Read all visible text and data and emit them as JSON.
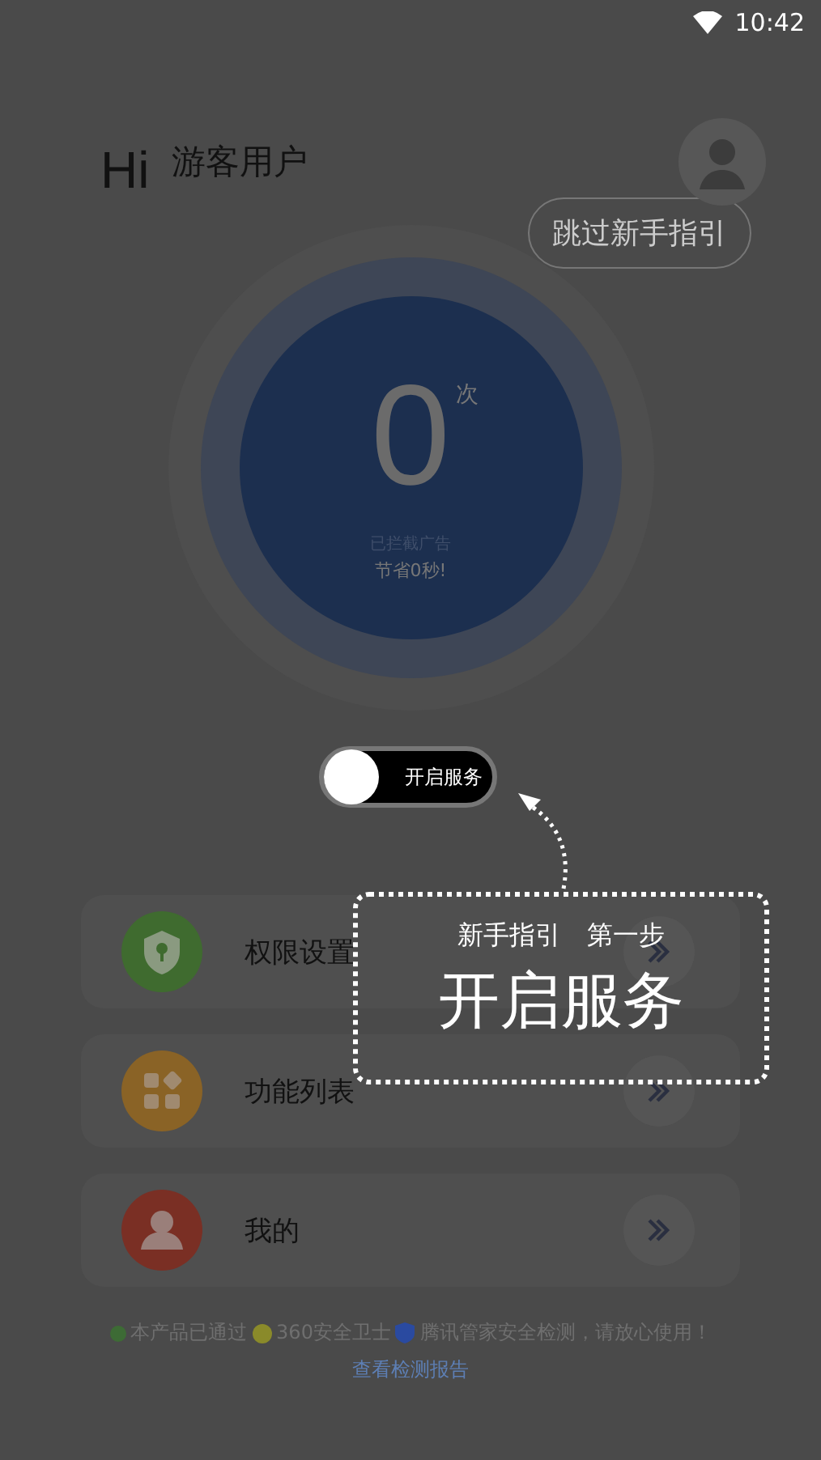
{
  "status_bar": {
    "time": "10:42"
  },
  "header": {
    "greeting": "Hi",
    "username": "游客用户",
    "skip_button": "跳过新手指引"
  },
  "counter": {
    "value": "0",
    "unit": "次",
    "caption": "已拦截广告",
    "saved": "节省0秒!"
  },
  "service_toggle": {
    "label": "开启服务",
    "on": false
  },
  "guide": {
    "step": "新手指引　第一步",
    "title": "开启服务"
  },
  "menu": [
    {
      "kind": "permission",
      "label": "权限设置",
      "color": "#3f6b2f"
    },
    {
      "kind": "features",
      "label": "功能列表",
      "color": "#8a6326"
    },
    {
      "kind": "mine",
      "label": "我的",
      "color": "#7a2f24"
    }
  ],
  "footer": {
    "prefix": "本产品已通过",
    "brand_a": "360安全卫士",
    "suffix": "腾讯管家安全检测，请放心使用！",
    "link": "查看检测报告"
  }
}
